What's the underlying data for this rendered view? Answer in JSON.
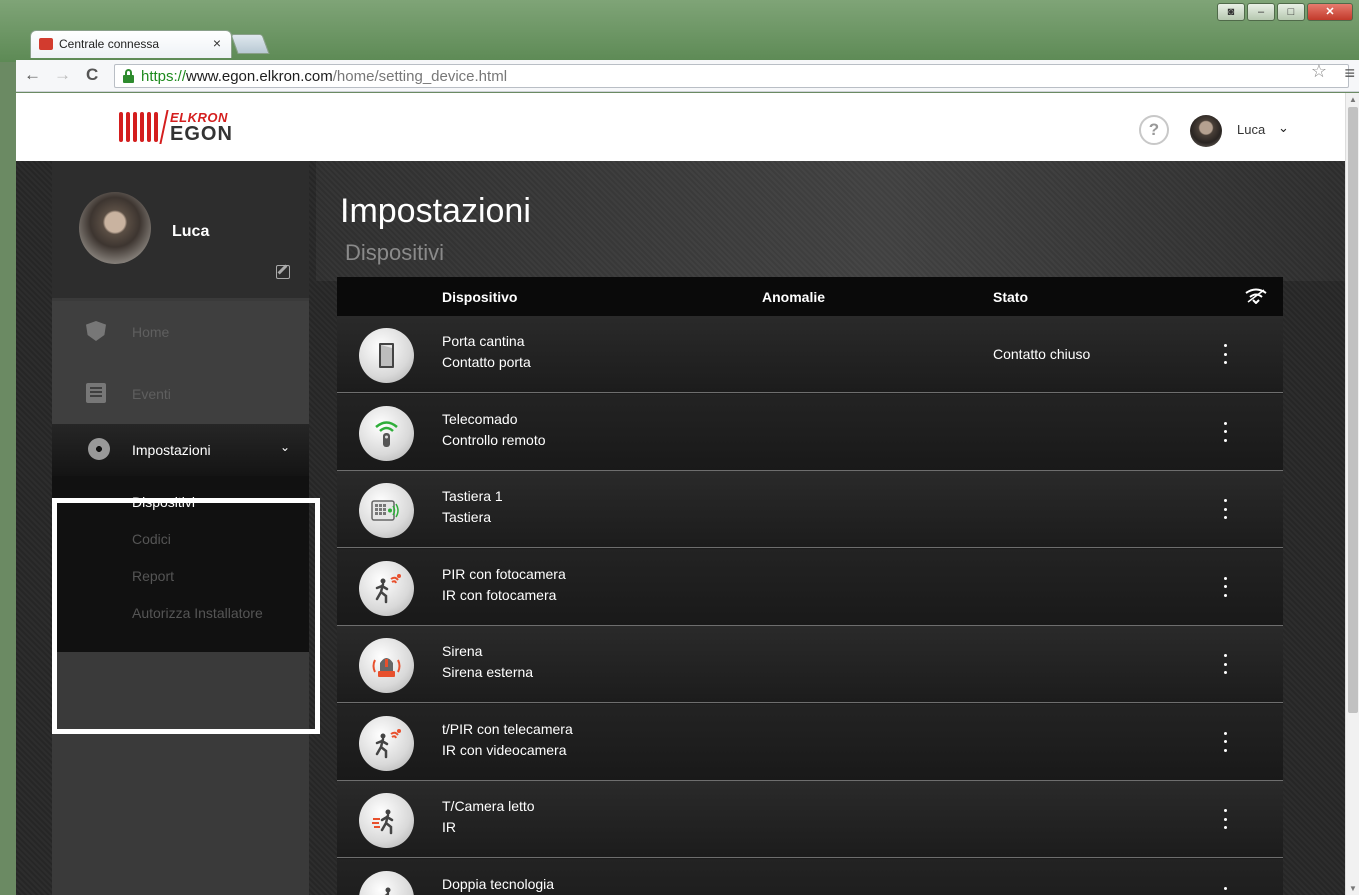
{
  "browser": {
    "tab_title": "Centrale connessa",
    "tab_close": "×",
    "url_proto": "https://",
    "url_host": "www.egon.elkron.com",
    "url_path": "/home/setting_device.html"
  },
  "header": {
    "logo_brand": "ELKRON",
    "logo_product": "EGON",
    "help": "?",
    "user_name": "Luca"
  },
  "sidebar": {
    "user_name": "Luca",
    "items": [
      {
        "label": "Home",
        "icon": "shield-icon"
      },
      {
        "label": "Eventi",
        "icon": "list-icon"
      }
    ],
    "settings": {
      "label": "Impostazioni",
      "sub_items": [
        {
          "label": "Dispositivi",
          "active": true
        },
        {
          "label": "Codici",
          "active": false
        },
        {
          "label": "Report",
          "active": false
        },
        {
          "label": "Autorizza Installatore",
          "active": false
        }
      ]
    }
  },
  "main": {
    "title": "Impostazioni",
    "subtitle": "Dispositivi",
    "columns": {
      "device": "Dispositivo",
      "anomalies": "Anomalie",
      "state": "Stato"
    },
    "devices": [
      {
        "name": "Porta cantina",
        "type": "Contatto porta",
        "state": "Contatto chiuso",
        "icon": "door-contact-icon"
      },
      {
        "name": "Telecomado",
        "type": "Controllo remoto",
        "state": "",
        "icon": "remote-control-icon"
      },
      {
        "name": "Tastiera 1",
        "type": "Tastiera",
        "state": "",
        "icon": "keypad-icon"
      },
      {
        "name": "PIR con fotocamera",
        "type": "IR con fotocamera",
        "state": "",
        "icon": "motion-sensor-icon"
      },
      {
        "name": "Sirena",
        "type": "Sirena esterna",
        "state": "",
        "icon": "siren-icon"
      },
      {
        "name": "t/PIR con telecamera",
        "type": "IR con videocamera",
        "state": "",
        "icon": "motion-sensor-icon"
      },
      {
        "name": "T/Camera letto",
        "type": "IR",
        "state": "",
        "icon": "running-man-icon"
      },
      {
        "name": "Doppia tecnologia",
        "type": "",
        "state": "",
        "icon": "running-man-icon"
      }
    ]
  },
  "colors": {
    "brand_red": "#d41e1e",
    "accent_green": "#2fae3a",
    "alert_orange": "#e8502d"
  }
}
